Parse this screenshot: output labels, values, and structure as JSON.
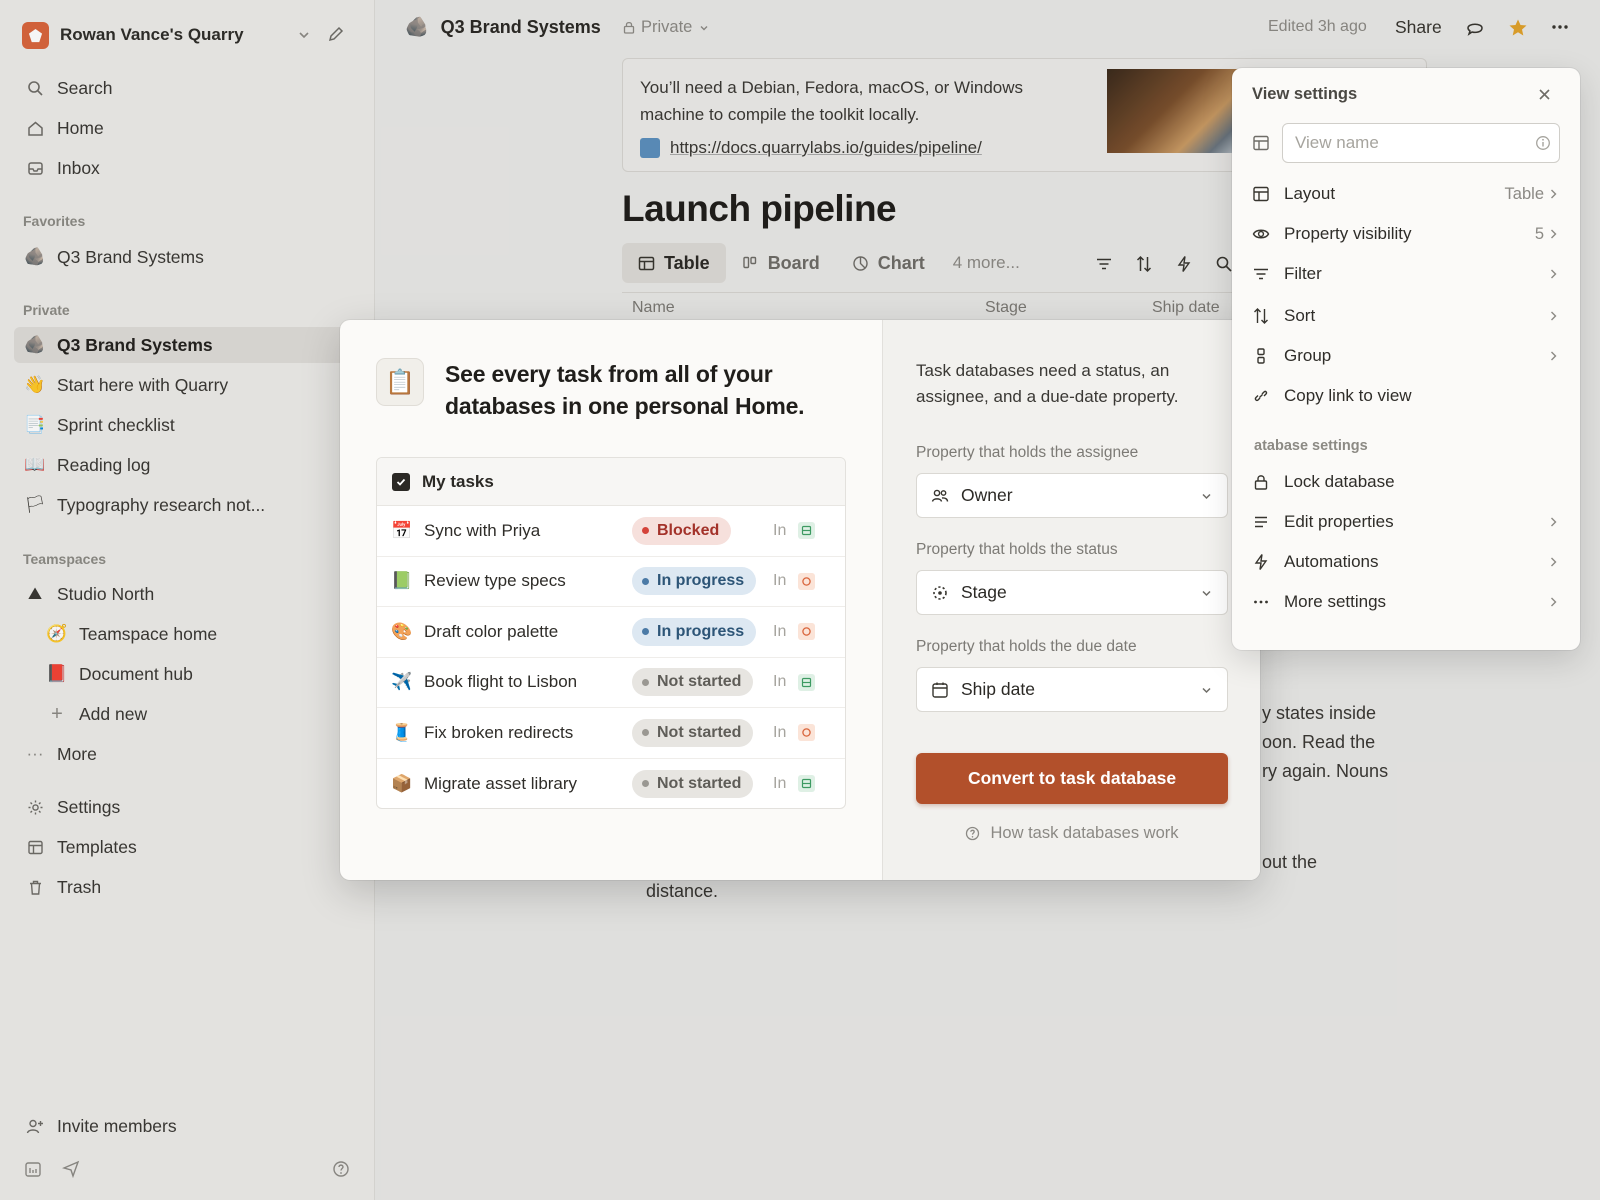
{
  "workspace": {
    "name": "Rowan Vance's Quarry",
    "color": "#d9653c"
  },
  "sidebar": {
    "top": [
      {
        "label": "Search",
        "icon": "search-icon"
      },
      {
        "label": "Home",
        "icon": "home-icon"
      },
      {
        "label": "Inbox",
        "icon": "inbox-icon"
      }
    ],
    "favorites_heading": "Favorites",
    "favorites": [
      {
        "label": "Q3 Brand Systems",
        "emoji": "🪨"
      }
    ],
    "private_heading": "Private",
    "private": [
      {
        "label": "Q3 Brand Systems",
        "emoji": "🪨"
      },
      {
        "label": "Start here with Quarry",
        "emoji": "👋"
      },
      {
        "label": "Sprint checklist",
        "emoji": "📑"
      },
      {
        "label": "Reading log",
        "emoji": "📖"
      },
      {
        "label": "Typography research not...",
        "emoji": "🏳"
      }
    ],
    "teamspaces_heading": "Teamspaces",
    "teamspace": {
      "label": "Studio North",
      "emoji": "⛰"
    },
    "teamspace_items": [
      {
        "label": "Teamspace home",
        "emoji": "🧭"
      },
      {
        "label": "Document hub",
        "emoji": "📕"
      },
      {
        "label": "Add new",
        "emoji": "+"
      }
    ],
    "more": "More",
    "bottom": [
      {
        "label": "Settings",
        "icon": "gear-icon"
      },
      {
        "label": "Templates",
        "icon": "templates-icon"
      },
      {
        "label": "Trash",
        "icon": "trash-icon"
      }
    ],
    "invite": "Invite members"
  },
  "topbar": {
    "page": "Q3 Brand Systems",
    "privacy": "Private",
    "edited": "Edited 3h ago",
    "share": "Share"
  },
  "bookmark": {
    "text": "You’ll need a Debian, Fedora, macOS, or Windows machine to compile the toolkit locally.",
    "url": "https://docs.quarrylabs.io/guides/pipeline/"
  },
  "page": {
    "title": "Launch pipeline",
    "views": [
      "Table",
      "Board",
      "Chart"
    ],
    "more_views": "4 more...",
    "columns": [
      "Name",
      "Stage",
      "Ship date"
    ],
    "body_fragments": [
      "y states inside",
      "oon. Read the",
      "ry again. Nouns",
      "out the",
      "distance."
    ]
  },
  "modal": {
    "heading": "See every task from all of your databases in one personal Home.",
    "tasks_title": "My tasks",
    "tasks": [
      {
        "emoji": "📅",
        "name": "Sync with Priya",
        "status": "Blocked",
        "kind": "blocked",
        "in": "In",
        "tag": "g"
      },
      {
        "emoji": "📗",
        "name": "Review type specs",
        "status": "In progress",
        "kind": "prog",
        "in": "In",
        "tag": "o"
      },
      {
        "emoji": "🎨",
        "name": "Draft color palette",
        "status": "In progress",
        "kind": "prog",
        "in": "In",
        "tag": "o"
      },
      {
        "emoji": "✈️",
        "name": "Book flight to Lisbon",
        "status": "Not started",
        "kind": "ns",
        "in": "In",
        "tag": "g"
      },
      {
        "emoji": "🧵",
        "name": "Fix broken redirects",
        "status": "Not started",
        "kind": "ns",
        "in": "In",
        "tag": "o"
      },
      {
        "emoji": "📦",
        "name": "Migrate asset library",
        "status": "Not started",
        "kind": "ns",
        "in": "In",
        "tag": "g"
      }
    ],
    "description": "Task databases need a status, an assignee, and a due-date property.",
    "assignee_label": "Property that holds the assignee",
    "assignee_value": "Owner",
    "status_label": "Property that holds the status",
    "status_value": "Stage",
    "due_label": "Property that holds the due date",
    "due_value": "Ship date",
    "convert_button": "Convert to task database",
    "help_link": "How task databases work",
    "accent": "#b2502b"
  },
  "view_settings": {
    "title": "View settings",
    "name_placeholder": "View name",
    "rows": [
      {
        "label": "Layout",
        "value": "Table",
        "icon": "layout-icon",
        "chevron": true
      },
      {
        "label": "Property visibility",
        "value": "5",
        "icon": "eye-icon",
        "chevron": true
      },
      {
        "label": "Filter",
        "value": "",
        "icon": "filter-icon",
        "chevron": true
      },
      {
        "label": "Sort",
        "value": "",
        "icon": "sort-icon",
        "chevron": true
      },
      {
        "label": "Group",
        "value": "",
        "icon": "group-icon",
        "chevron": true
      },
      {
        "label": "Copy link to view",
        "value": "",
        "icon": "link-icon",
        "chevron": false
      }
    ],
    "db_heading": "atabase settings",
    "db_rows": [
      {
        "label": "Lock database",
        "icon": "lock-icon",
        "chevron": false
      },
      {
        "label": "Edit properties",
        "icon": "list-icon",
        "chevron": true
      },
      {
        "label": "Automations",
        "icon": "bolt-icon",
        "chevron": true
      },
      {
        "label": "More settings",
        "icon": "dots-icon",
        "chevron": true
      }
    ]
  }
}
